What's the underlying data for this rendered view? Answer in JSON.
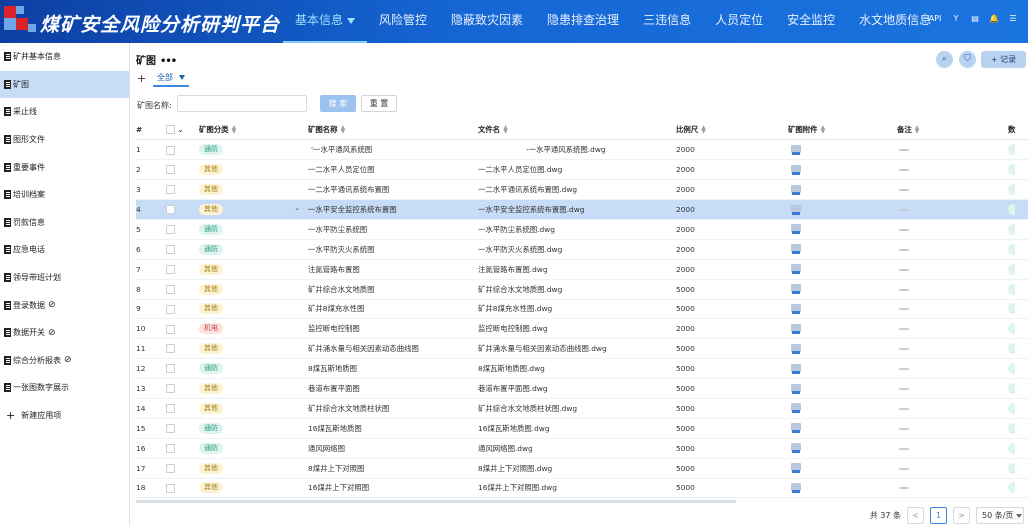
{
  "header": {
    "title": "煤矿安全风险分析研判平台",
    "nav": [
      {
        "label": "基本信息",
        "active": true
      },
      {
        "label": "风险管控",
        "active": false
      },
      {
        "label": "隐蔽致灾因素",
        "active": false
      },
      {
        "label": "隐患排查治理",
        "active": false
      },
      {
        "label": "三违信息",
        "active": false
      },
      {
        "label": "人员定位",
        "active": false
      },
      {
        "label": "安全监控",
        "active": false
      },
      {
        "label": "水文地质信息",
        "active": false
      }
    ],
    "icons": [
      "API",
      "Y",
      "▤",
      "🔔",
      "☰"
    ]
  },
  "sidebar": {
    "items": [
      {
        "label": "矿井基本信息",
        "icon": "doc-icon",
        "hidden_flag": false
      },
      {
        "label": "矿图",
        "icon": "doc-icon",
        "hidden_flag": false,
        "active": true
      },
      {
        "label": "采止线",
        "icon": "doc-icon",
        "hidden_flag": false
      },
      {
        "label": "图形文件",
        "icon": "doc-icon",
        "hidden_flag": false
      },
      {
        "label": "重要事件",
        "icon": "doc-icon",
        "hidden_flag": false
      },
      {
        "label": "培训档案",
        "icon": "doc-icon",
        "hidden_flag": false
      },
      {
        "label": "罚款信息",
        "icon": "doc-icon",
        "hidden_flag": false
      },
      {
        "label": "应急电话",
        "icon": "doc-icon",
        "hidden_flag": false
      },
      {
        "label": "领导带班计划",
        "icon": "doc-icon",
        "hidden_flag": false
      },
      {
        "label": "登录数据",
        "icon": "doc-icon",
        "hidden_flag": true
      },
      {
        "label": "数据开关",
        "icon": "doc-icon",
        "hidden_flag": true
      },
      {
        "label": "综合分析报表",
        "icon": "doc-icon",
        "hidden_flag": true
      },
      {
        "label": "一张图数字展示",
        "icon": "doc-icon",
        "hidden_flag": false
      }
    ],
    "new_app_label": "新建应用项"
  },
  "page": {
    "title": "矿图",
    "more": "•••",
    "tab_all": "全部",
    "filter_label": "矿图名称:",
    "filter_value": "",
    "search_label": "搜 索",
    "reset_label": "重 置",
    "record_label": "+ 记录",
    "search_icon": "⌕",
    "filter_icon": "⛉"
  },
  "table": {
    "columns": [
      "#",
      "",
      "矿图分类",
      "矿图名称",
      "文件名",
      "比例尺",
      "矿图附件",
      "备注",
      "数"
    ],
    "rows": [
      {
        "no": "1",
        "cat": "通防",
        "name": "一水平通风系统图",
        "file": "一水平通风系统图.dwg",
        "scale": "2000",
        "name_prefix": "'",
        "file_prefix": "-",
        "name_clip": true
      },
      {
        "no": "2",
        "cat": "其他",
        "name": "一二水平人员定位图",
        "file": "一二水平人员定位图.dwg",
        "scale": "2000"
      },
      {
        "no": "3",
        "cat": "其他",
        "name": "一二水平通讯系统布置图",
        "file": "一二水平通讯系统布置图.dwg",
        "scale": "2000"
      },
      {
        "no": "4",
        "cat": "其他",
        "name": "一水平安全监控系统布置图",
        "file": "一水平安全监控系统布置图.dwg",
        "scale": "2000",
        "selected": true
      },
      {
        "no": "5",
        "cat": "通防",
        "name": "一水平防尘系统图",
        "file": "一水平防尘系统图.dwg",
        "scale": "2000"
      },
      {
        "no": "6",
        "cat": "通防",
        "name": "一水平防灭火系统图",
        "file": "一水平防灭火系统图.dwg",
        "scale": "2000"
      },
      {
        "no": "7",
        "cat": "其他",
        "name": "注氮管路布置图",
        "file": "注氮管路布置图.dwg",
        "scale": "2000"
      },
      {
        "no": "8",
        "cat": "其他",
        "name": "矿井综合水文地质图",
        "file": "矿井综合水文地质图.dwg",
        "scale": "5000"
      },
      {
        "no": "9",
        "cat": "其他",
        "name": "矿井8煤充水性图",
        "file": "矿井8煤充水性图.dwg",
        "scale": "5000"
      },
      {
        "no": "10",
        "cat": "机电",
        "name": "监控断电控制图",
        "file": "监控断电控制图.dwg",
        "scale": "2000"
      },
      {
        "no": "11",
        "cat": "其他",
        "name": "矿井涌水量与相关因素动态曲线图",
        "file": "矿井涌水量与相关因素动态曲线图.dwg",
        "scale": "5000"
      },
      {
        "no": "12",
        "cat": "通防",
        "name": "8煤瓦斯地质图",
        "file": "8煤瓦斯地质图.dwg",
        "scale": "5000"
      },
      {
        "no": "13",
        "cat": "其他",
        "name": "巷道布置平面图",
        "file": "巷道布置平面图.dwg",
        "scale": "5000"
      },
      {
        "no": "14",
        "cat": "其他",
        "name": "矿井综合水文地质柱状图",
        "file": "矿井综合水文地质柱状图.dwg",
        "scale": "5000"
      },
      {
        "no": "15",
        "cat": "通防",
        "name": "16煤瓦斯地质图",
        "file": "16煤瓦斯地质图.dwg",
        "scale": "5000"
      },
      {
        "no": "16",
        "cat": "通防",
        "name": "通风网络图",
        "file": "通风网络图.dwg",
        "scale": "5000"
      },
      {
        "no": "17",
        "cat": "其他",
        "name": "8煤井上下对照图",
        "file": "8煤井上下对照图.dwg",
        "scale": "5000"
      },
      {
        "no": "18",
        "cat": "其他",
        "name": "16煤井上下对照图",
        "file": "16煤井上下对照图.dwg",
        "scale": "5000"
      }
    ]
  },
  "pager": {
    "total": "共 37 条",
    "prev": "<",
    "current": "1",
    "next": ">",
    "page_size": "50 条/页"
  },
  "colors": {
    "header_start": "#0d3fa3",
    "header_end": "#1a74e0",
    "nav_active": "#9fe3ff",
    "selected_row": "#c7dcf6",
    "primary": "#3a86e0"
  }
}
